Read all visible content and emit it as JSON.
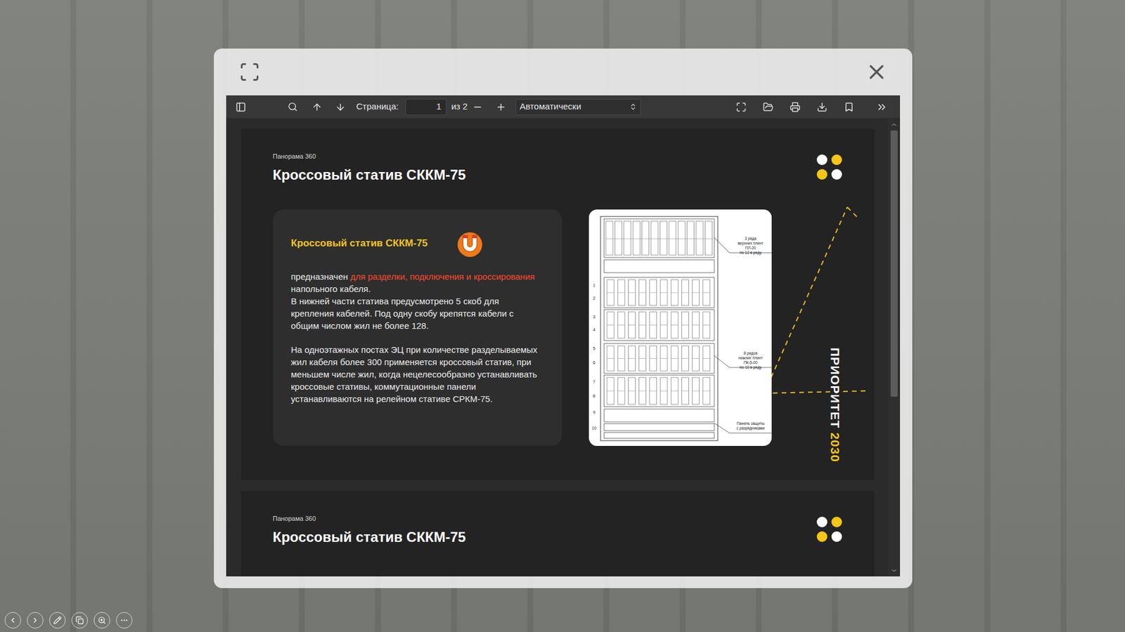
{
  "viewer": {
    "page_label": "Страница:",
    "page_value": "1",
    "page_total": "из 2",
    "zoom": "Автоматически"
  },
  "pages": [
    {
      "caption": "Панорама 360",
      "title": "Кроссовый статив СККМ-75",
      "card": {
        "heading": "Кроссовый статив СККМ-75",
        "groups": [
          [
            [
              {
                "text": "предназначен ",
                "highlight": false
              },
              {
                "text": "для разделки, подключения и кроссирования",
                "highlight": true
              },
              {
                "text": " напольного кабеля.",
                "highlight": false
              }
            ],
            [
              {
                "text": "В нижней части статива предусмотрено 5 скоб для крепления кабелей. Под одну скобу крепятся кабели с общим числом жил не более 128.",
                "highlight": false
              }
            ]
          ],
          [
            [
              {
                "text": "На одноэтажных постах ЭЦ при количестве разделываемых жил кабеля более 300 применяется кроссовый статив, при меньшем числе жил, когда нецелесообразно устанавливать кроссовые стативы, коммутационные панели устанавливаются на релейном стативе СРКМ-75.",
                "highlight": false
              }
            ]
          ]
        ]
      },
      "diagram": {
        "row_numbers": [
          "1",
          "2",
          "3",
          "4",
          "5",
          "6",
          "7",
          "8",
          "9",
          "10"
        ],
        "labels": [
          {
            "lines": [
              "3 ряда",
              "верхних плинт",
              "ПЛ-20",
              "по 12 в ряду"
            ]
          },
          {
            "lines": [
              "8 рядов",
              "нижних плинт",
              "ПК-5-00",
              "по 10 в ряду"
            ]
          },
          {
            "lines": [
              "Панель защиты",
              "с разрядниками"
            ]
          }
        ]
      },
      "badge": {
        "word": "ПРИОРИТЕТ",
        "year": "2030"
      }
    },
    {
      "caption": "Панорама 360",
      "title": "Кроссовый статив СККМ-75"
    }
  ]
}
